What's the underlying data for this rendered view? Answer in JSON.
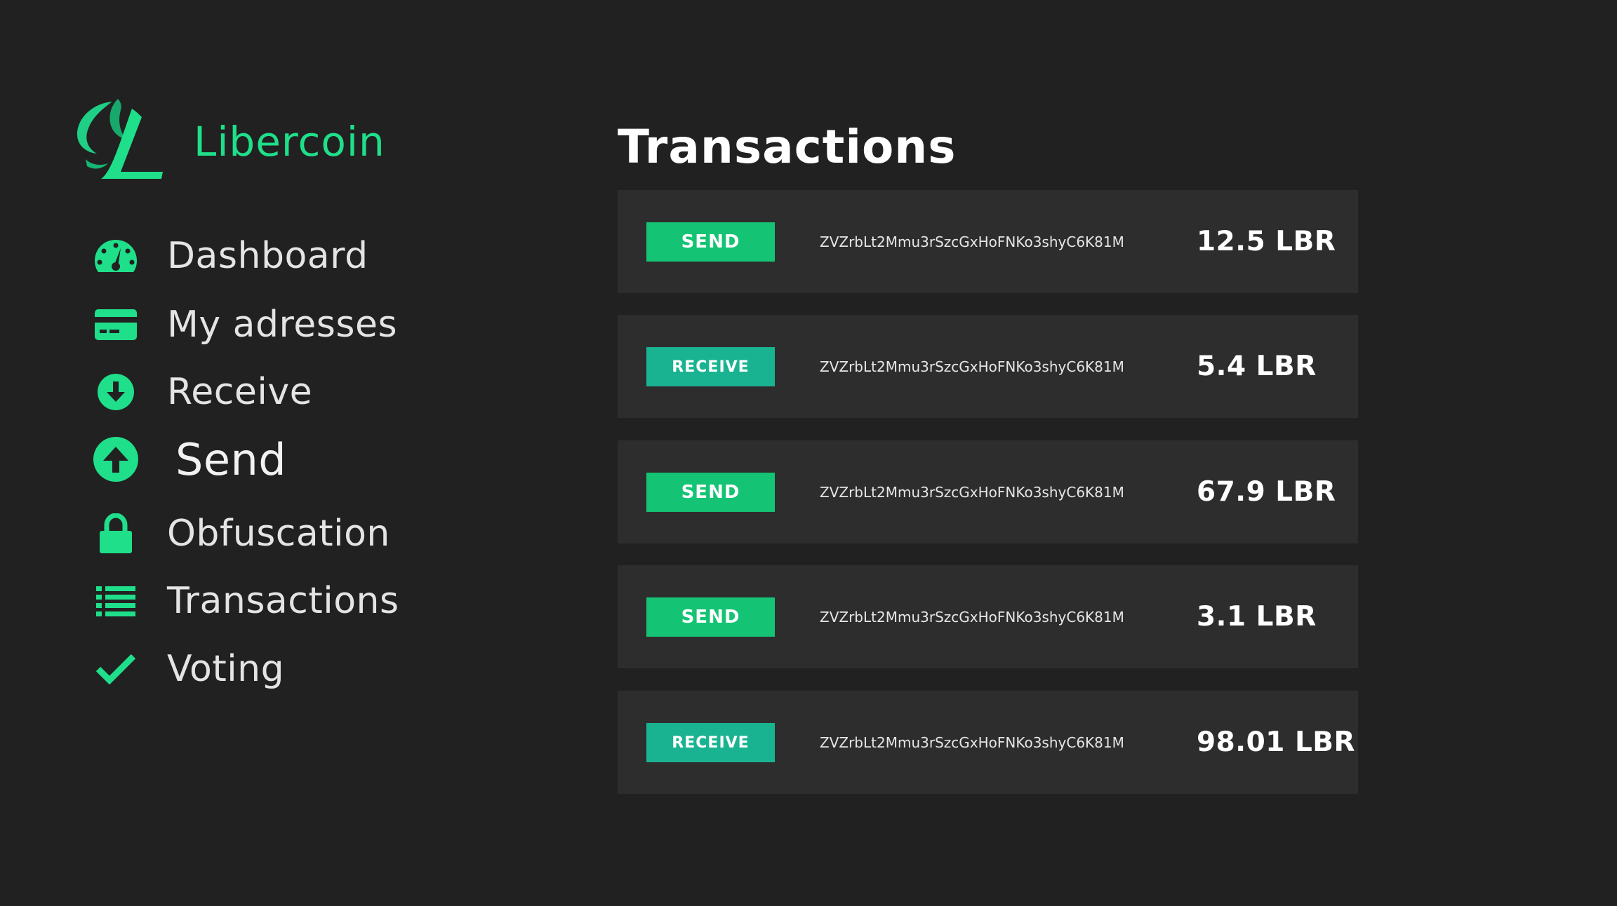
{
  "brand": {
    "name": "Libercoin",
    "accent_color": "#1fdf8a"
  },
  "sidebar": {
    "items": [
      {
        "label": "Dashboard",
        "icon": "speedometer-icon"
      },
      {
        "label": "My adresses",
        "icon": "credit-card-icon"
      },
      {
        "label": "Receive",
        "icon": "arrow-down-circle-icon"
      },
      {
        "label": "Send",
        "icon": "arrow-up-circle-icon",
        "active": true
      },
      {
        "label": "Obfuscation",
        "icon": "lock-icon"
      },
      {
        "label": "Transactions",
        "icon": "list-icon"
      },
      {
        "label": "Voting",
        "icon": "check-icon"
      }
    ]
  },
  "main": {
    "title": "Transactions",
    "transactions": [
      {
        "type": "SEND",
        "address": "ZVZrbLt2Mmu3rSzcGxHoFNKo3shyC6K81M",
        "amount": "12.5 LBR"
      },
      {
        "type": "RECEIVE",
        "address": "ZVZrbLt2Mmu3rSzcGxHoFNKo3shyC6K81M",
        "amount": "5.4 LBR"
      },
      {
        "type": "SEND",
        "address": "ZVZrbLt2Mmu3rSzcGxHoFNKo3shyC6K81M",
        "amount": "67.9 LBR"
      },
      {
        "type": "SEND",
        "address": "ZVZrbLt2Mmu3rSzcGxHoFNKo3shyC6K81M",
        "amount": "3.1 LBR"
      },
      {
        "type": "RECEIVE",
        "address": "ZVZrbLt2Mmu3rSzcGxHoFNKo3shyC6K81M",
        "amount": "98.01 LBR"
      }
    ]
  },
  "colors": {
    "background": "#212121",
    "row_background": "#2d2d2d",
    "send_badge": "#14c373",
    "receive_badge": "#1ab391",
    "icon_green": "#1fdf8a"
  }
}
